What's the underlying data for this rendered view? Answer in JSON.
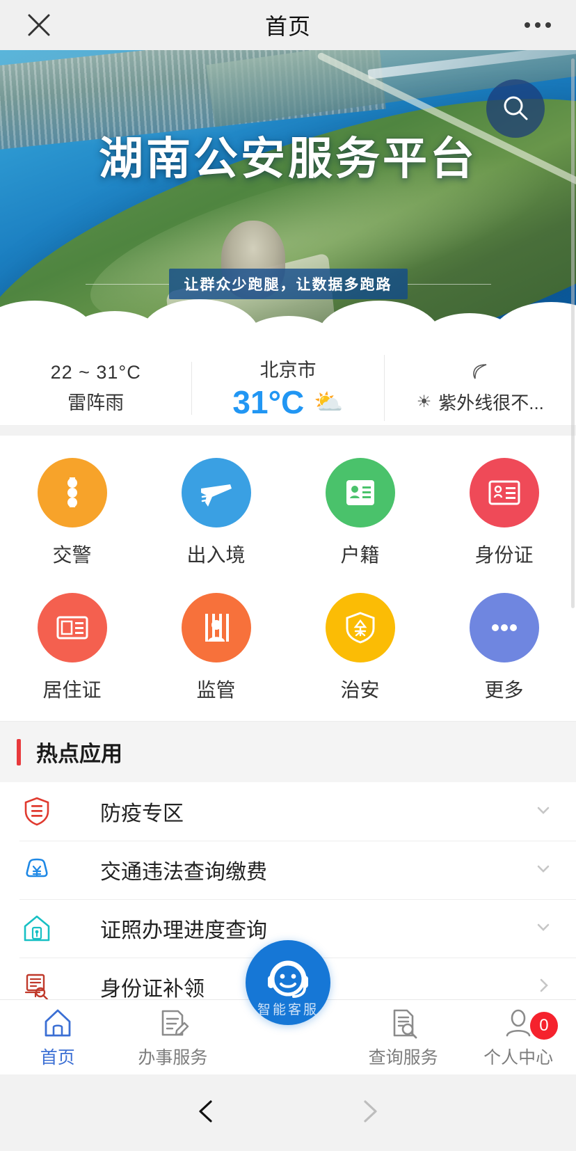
{
  "titlebar": {
    "title": "首页",
    "close_icon": "close-icon",
    "more_icon": "more-dots-icon"
  },
  "banner": {
    "title": "湖南公安服务平台",
    "subtitle": "让群众少跑腿，让数据多跑路",
    "search_icon": "search-icon"
  },
  "weather": {
    "range": "22 ~ 31°C",
    "condition": "雷阵雨",
    "city": "北京市",
    "temp": "31°C",
    "temp_color": "#2196f3",
    "weather_icon": "sun-behind-cloud-icon",
    "leaf_icon": "leaf-icon",
    "uv_icon": "sun-icon",
    "uv_text": "紫外线很不..."
  },
  "quick_grid": {
    "rows": [
      [
        {
          "label": "交警",
          "icon": "traffic-light-icon",
          "color": "#f7a32a"
        },
        {
          "label": "出入境",
          "icon": "airplane-icon",
          "color": "#3aa0e3"
        },
        {
          "label": "户籍",
          "icon": "id-card-icon",
          "color": "#4ac26b"
        },
        {
          "label": "身份证",
          "icon": "identity-card-icon",
          "color": "#ef4a58"
        }
      ],
      [
        {
          "label": "居住证",
          "icon": "residence-permit-icon",
          "color": "#f4604f"
        },
        {
          "label": "监管",
          "icon": "prison-icon",
          "color": "#f7713b"
        },
        {
          "label": "治安",
          "icon": "security-shield-icon",
          "color": "#fbbc05"
        },
        {
          "label": "更多",
          "icon": "more-dots-icon",
          "color": "#6f86e0"
        }
      ]
    ]
  },
  "hot_section": {
    "title": "热点应用",
    "accent_color": "#e8393c"
  },
  "hot_list": [
    {
      "label": "防疫专区",
      "icon": "epidemic-shield-icon",
      "icon_color": "#e03a2f",
      "chevron": "chevron-down-icon"
    },
    {
      "label": "交通违法查询缴费",
      "icon": "car-payment-icon",
      "icon_color": "#1e88e5",
      "chevron": "chevron-down-icon"
    },
    {
      "label": "证照办理进度查询",
      "icon": "house-progress-icon",
      "icon_color": "#17c0c4",
      "chevron": "chevron-down-icon"
    },
    {
      "label": "身份证补领",
      "icon": "document-search-icon",
      "icon_color": "#c0392b",
      "chevron": "chevron-right-icon"
    }
  ],
  "tabbar": {
    "items": [
      {
        "label": "首页",
        "icon": "home-icon",
        "active": true
      },
      {
        "label": "办事服务",
        "icon": "document-pencil-icon",
        "active": false
      },
      {
        "label": "查询服务",
        "icon": "document-search-icon",
        "active": false
      },
      {
        "label": "个人中心",
        "icon": "person-icon",
        "active": false,
        "badge": "0"
      }
    ],
    "center": {
      "label": "智能客服",
      "icon": "headset-smiley-icon",
      "color": "#1677d6"
    },
    "active_color": "#3b6fd4",
    "badge_color": "#f5222d"
  },
  "botnav": {
    "back_icon": "chevron-left-icon",
    "forward_icon": "chevron-right-icon"
  }
}
